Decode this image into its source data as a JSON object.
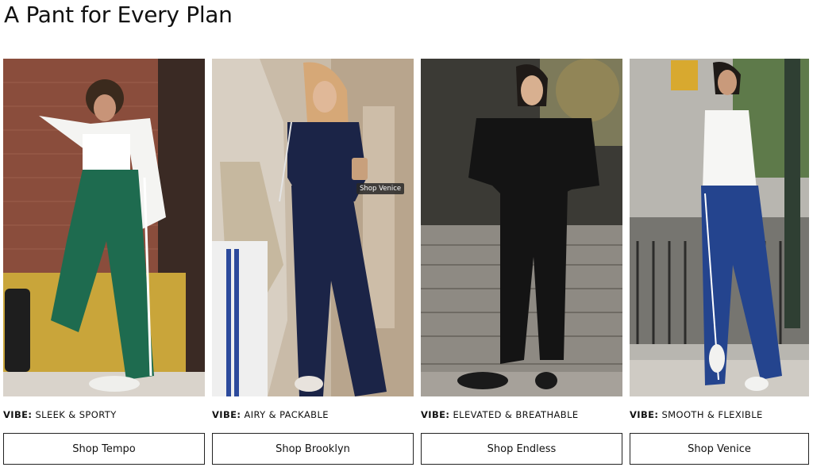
{
  "page": {
    "title": "A Pant for Every Plan"
  },
  "cards": [
    {
      "vibe_key": "VIBE:",
      "vibe": "SLEEK & SPORTY",
      "button": "Shop Tempo"
    },
    {
      "vibe_key": "VIBE:",
      "vibe": "AIRY & PACKABLE",
      "button": "Shop Brooklyn",
      "tooltip": "Shop Venice"
    },
    {
      "vibe_key": "VIBE:",
      "vibe": "ELEVATED & BREATHABLE",
      "button": "Shop Endless"
    },
    {
      "vibe_key": "VIBE:",
      "vibe": "SMOOTH & FLEXIBLE",
      "button": "Shop Venice"
    }
  ],
  "colors": {
    "tempo_pant": "#1e6b4f",
    "brooklyn_outfit": "#1b2447",
    "endless_outfit": "#141414",
    "venice_pant": "#24448e"
  }
}
